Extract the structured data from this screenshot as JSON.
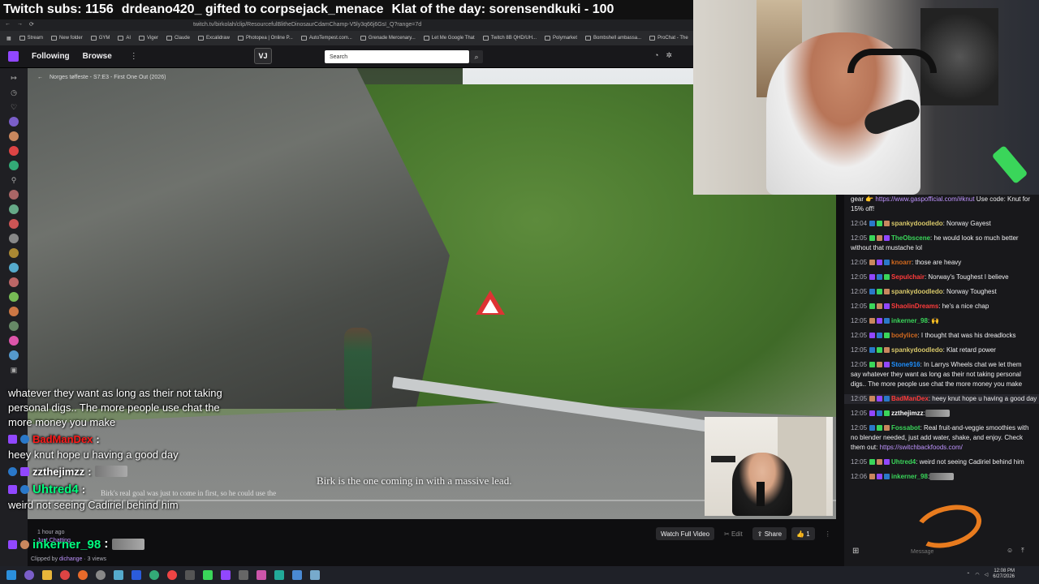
{
  "ticker": {
    "subs": "Twitch subs: 1156",
    "gifted": "drdeano420_ gifted to corpsejack_menace",
    "klat": "Klat of the day: sorensendkuki - 100"
  },
  "browser": {
    "url": "twitch.tv/birkolah/clip/ResourcefulBlitheDinosaurCdamChamp-V5ly3q66j6GsI_Q?range=7d",
    "bookmarks": [
      "Stream",
      "New folder",
      "GYM",
      "AI",
      "Viger",
      "Claude",
      "Excalidraw",
      "Photopea | Online P...",
      "AutoTempest.com...",
      "Grenade Mercenary...",
      "Let Me Google That",
      "Twitch 8B QHD/UH...",
      "Polymarket",
      "Bombshell ambassa...",
      "ProChat - The"
    ]
  },
  "nav": {
    "following": "Following",
    "browse": "Browse",
    "more": "⋮",
    "vj": "VJ",
    "search_placeholder": "Search"
  },
  "video": {
    "breadcrumb_back": "←",
    "breadcrumb": "Norges tøffeste - S7:E3 - First One Out (2026)",
    "subtitle": "Birk is the one coming in with a massive lead.",
    "subtitle_small": "Birk's real goal was just to come in first, so he could use the"
  },
  "overlay_chat": {
    "msg1": "whatever they want as long as their not taking personal digs.. The more people use chat the more money you make",
    "user2": "BadManDex",
    "msg2": "heey knut hope u having a good day",
    "user3": "zzthejimzz",
    "user4": "Uhtred4",
    "msg4": "weird not seeing Cadiriel behind him",
    "user5": "inkerner_98"
  },
  "clip": {
    "time_ago": "1 hour ago",
    "category": "Just Chatting",
    "clipped_by_prefix": "Clipped by",
    "clipped_by": "dichange",
    "views": "· 3 views",
    "watch_full": "Watch Full Video",
    "edit": "Edit",
    "share": "Share",
    "likes": "1"
  },
  "chat": {
    "messages": [
      {
        "time": "",
        "name": "",
        "name_color": "#ffffff",
        "text": "gear 👉 ",
        "link": "https://www.gaspofficial.com/#knut",
        "after": " Use code: Knut for 15% off!"
      },
      {
        "time": "12:04",
        "name": "spankydoodledo",
        "name_color": "#d8c86a",
        "text": ": Norway Gayest"
      },
      {
        "time": "12:05",
        "name": "TheObscene",
        "name_color": "#3ad65a",
        "text": ": he would look so much better without that mustache lol"
      },
      {
        "time": "12:05",
        "name": "knoarr",
        "name_color": "#d2691e",
        "text": ": those are heavy"
      },
      {
        "time": "12:05",
        "name": "Sepulchair",
        "name_color": "#ff3b3b",
        "text": ": Norway's Toughest I believe"
      },
      {
        "time": "12:05",
        "name": "spankydoodledo",
        "name_color": "#d8c86a",
        "text": ": Norway Toughest"
      },
      {
        "time": "12:05",
        "name": "ShaolinDreams",
        "name_color": "#ff3b3b",
        "text": ": he's a nice chap"
      },
      {
        "time": "12:05",
        "name": "inkerner_98",
        "name_color": "#3ad65a",
        "text": ": 🙌"
      },
      {
        "time": "12:05",
        "name": "bodylice",
        "name_color": "#d2691e",
        "text": ": I thought that was his dreadlocks"
      },
      {
        "time": "12:05",
        "name": "spankydoodledo",
        "name_color": "#d8c86a",
        "text": ": Klat retard power"
      },
      {
        "time": "12:05",
        "name": "Stone916",
        "name_color": "#1e90ff",
        "text": ": In Larrys Wheels chat we let them say whatever they want as long as their not taking personal digs.. The more people use chat the more money you make"
      },
      {
        "time": "12:05",
        "name": "BadManDex",
        "name_color": "#ff3b3b",
        "text": ": heey knut hope u having a good day"
      },
      {
        "time": "12:05",
        "name": "zzthejimzz",
        "name_color": "#ffffff",
        "text": ":"
      },
      {
        "time": "12:05",
        "name": "Fossabot",
        "name_color": "#3ad65a",
        "text": ": Real fruit-and-veggie smoothies with no blender needed, just add water, shake, and enjoy. Check them out: ",
        "link": "https://switchbackfoods.com/"
      },
      {
        "time": "12:05",
        "name": "Uhtred4",
        "name_color": "#3ad65a",
        "text": ": weird not seeing Cadiriel behind him"
      },
      {
        "time": "12:06",
        "name": "inkerner_98",
        "name_color": "#3ad65a",
        "text": ":"
      }
    ],
    "input_placeholder": "Message"
  },
  "taskbar": {
    "time": "12:08 PM",
    "date": "6/27/2026"
  },
  "colors": {
    "twitch_purple": "#9147ff",
    "link": "#bf94ff",
    "bg": "#0e0e10",
    "panel": "#18181b"
  }
}
